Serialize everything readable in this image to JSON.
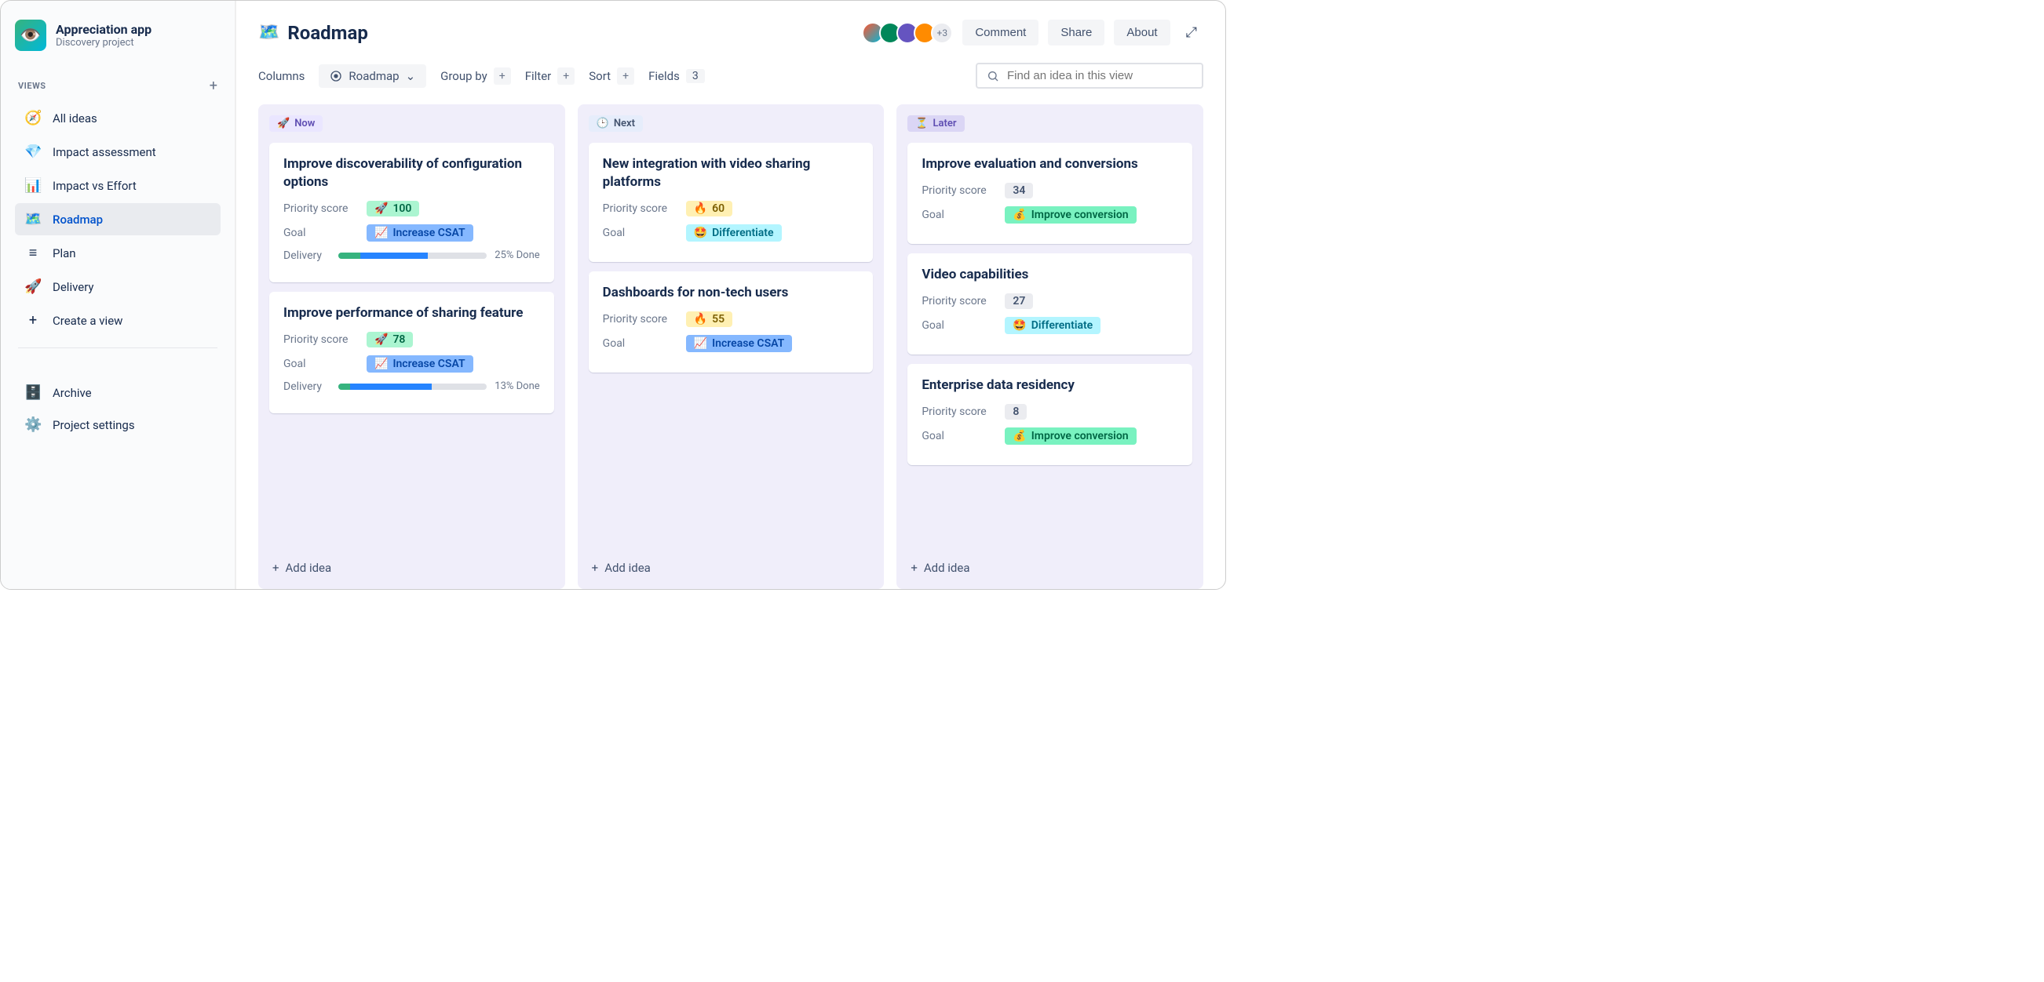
{
  "app": {
    "name": "Appreciation app",
    "subtitle": "Discovery project"
  },
  "sidebar": {
    "views_label": "VIEWS",
    "items": [
      {
        "icon": "🧭",
        "label": "All ideas"
      },
      {
        "icon": "💎",
        "label": "Impact assessment"
      },
      {
        "icon": "📊",
        "label": "Impact vs Effort"
      },
      {
        "icon": "🗺️",
        "label": "Roadmap"
      },
      {
        "icon": "≡",
        "label": "Plan"
      },
      {
        "icon": "🚀",
        "label": "Delivery"
      },
      {
        "icon": "+",
        "label": "Create a view"
      }
    ],
    "bottom": [
      {
        "label": "Archive"
      },
      {
        "label": "Project settings"
      }
    ]
  },
  "header": {
    "title_emoji": "🗺️",
    "title": "Roadmap",
    "avatar_more": "+3",
    "buttons": {
      "comment": "Comment",
      "share": "Share",
      "about": "About"
    }
  },
  "toolbar": {
    "columns": "Columns",
    "roadmap": "Roadmap",
    "groupby": "Group by",
    "filter": "Filter",
    "sort": "Sort",
    "fields": "Fields",
    "fields_count": "3",
    "search_placeholder": "Find an idea in this view"
  },
  "labels": {
    "priority": "Priority score",
    "goal": "Goal",
    "delivery": "Delivery",
    "add_idea": "Add idea"
  },
  "columns": [
    {
      "header_icon": "🚀",
      "header": "Now",
      "header_class": "hdr-now",
      "cards": [
        {
          "title": "Improve discoverability of configuration options",
          "score": "100",
          "score_class": "score-green",
          "score_icon": "🚀",
          "goal": "Increase CSAT",
          "goal_icon": "📈",
          "goal_class": "goal-blue",
          "delivery_pct": "25% Done",
          "pg_green": 15,
          "pg_blue": 45
        },
        {
          "title": "Improve performance of sharing feature",
          "score": "78",
          "score_class": "score-green",
          "score_icon": "🚀",
          "goal": "Increase CSAT",
          "goal_icon": "📈",
          "goal_class": "goal-blue",
          "delivery_pct": "13% Done",
          "pg_green": 8,
          "pg_blue": 55
        }
      ]
    },
    {
      "header_icon": "🕒",
      "header": "Next",
      "header_class": "hdr-next",
      "cards": [
        {
          "title": "New integration with video sharing platforms",
          "score": "60",
          "score_class": "score-yellow",
          "score_icon": "🔥",
          "goal": "Differentiate",
          "goal_icon": "🤩",
          "goal_class": "goal-teal"
        },
        {
          "title": "Dashboards for non-tech users",
          "score": "55",
          "score_class": "score-yellow",
          "score_icon": "🔥",
          "goal": "Increase CSAT",
          "goal_icon": "📈",
          "goal_class": "goal-blue"
        }
      ]
    },
    {
      "header_icon": "⏳",
      "header": "Later",
      "header_class": "hdr-later",
      "cards": [
        {
          "title": "Improve evaluation and conversions",
          "score": "34",
          "score_class": "score-gray",
          "goal": "Improve conversion",
          "goal_icon": "💰",
          "goal_class": "goal-green"
        },
        {
          "title": "Video capabilities",
          "score": "27",
          "score_class": "score-gray",
          "goal": "Differentiate",
          "goal_icon": "🤩",
          "goal_class": "goal-teal"
        },
        {
          "title": "Enterprise data residency",
          "score": "8",
          "score_class": "score-gray",
          "goal": "Improve conversion",
          "goal_icon": "💰",
          "goal_class": "goal-green"
        }
      ]
    }
  ]
}
